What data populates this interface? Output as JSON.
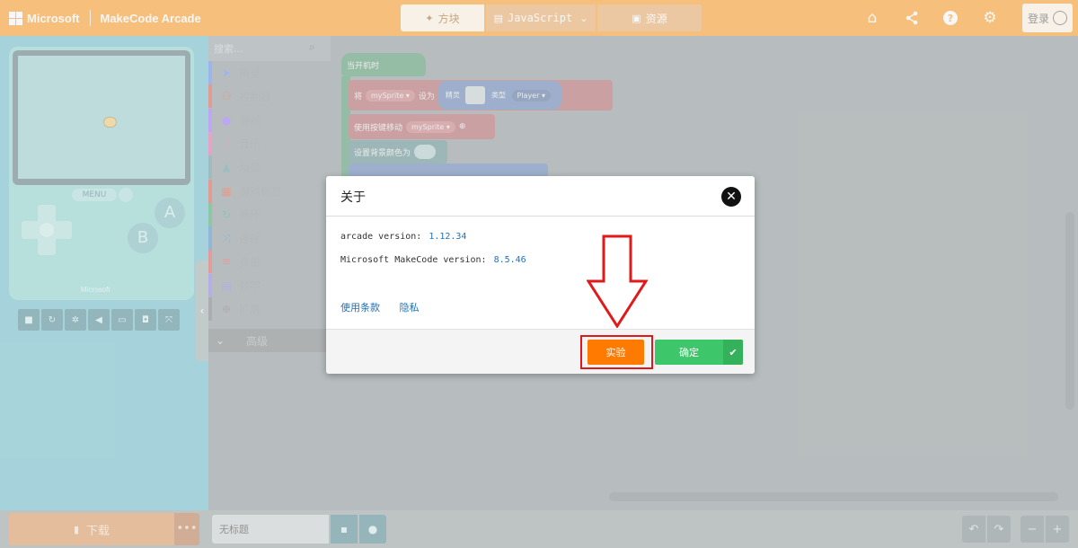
{
  "header": {
    "brand_ms": "Microsoft",
    "brand_app": "MakeCode Arcade",
    "tabs": [
      {
        "label": "方块",
        "icon": "puzzle-icon",
        "active": true
      },
      {
        "label": "JavaScript",
        "icon": "js-icon"
      },
      {
        "label": "资源",
        "icon": "image-icon"
      }
    ],
    "icons": [
      "home-icon",
      "share-icon",
      "help-icon",
      "settings-icon"
    ],
    "signin_label": "登录",
    "accent": "#ff8f08"
  },
  "simulator": {
    "menu_label": "MENU",
    "button_a": "A",
    "button_b": "B",
    "console_brand": "Microsoft",
    "toolbar_icons": [
      "stop-icon",
      "restart-icon",
      "debug-icon",
      "sound-icon",
      "keyboard-icon",
      "screenshot-icon",
      "fullscreen-icon"
    ]
  },
  "toolbox": {
    "search_placeholder": "搜索...",
    "categories": [
      {
        "label": "精灵",
        "color": "#4b7bec"
      },
      {
        "label": "控制器",
        "color": "#d6472f"
      },
      {
        "label": "游戏",
        "color": "#8b5cf6"
      },
      {
        "label": "音乐",
        "color": "#e0559c"
      },
      {
        "label": "场景",
        "color": "#4b8b8f"
      },
      {
        "label": "游戏信息",
        "color": "#d6472f"
      },
      {
        "label": "循环",
        "color": "#23a35a"
      },
      {
        "label": "逻辑",
        "color": "#2f7fc0"
      },
      {
        "label": "变量",
        "color": "#d64848"
      },
      {
        "label": "数学",
        "color": "#7b6ad8"
      },
      {
        "label": "扩展",
        "color": "#6a6a6a"
      }
    ],
    "advanced_label": "高级"
  },
  "workspace": {
    "on_start": "当开机时",
    "set_prefix": "将",
    "var_name": "mySprite",
    "set_to": "设为",
    "sprite_word": "精灵",
    "kind_word": "类型",
    "kind_value": "Player",
    "move_label": "使用按键移动",
    "bg_label": "设置背景颜色为"
  },
  "bottom": {
    "download_label": "下载",
    "more_label": "•••",
    "project_name": "无标题"
  },
  "modal": {
    "title": "关于",
    "close_icon": "close-icon",
    "arcade_version_label": "arcade version:",
    "arcade_version": "1.12.34",
    "makecode_version_label": "Microsoft MakeCode version:",
    "makecode_version": "8.5.46",
    "terms_link": "使用条款",
    "privacy_link": "隐私",
    "experiments_label": "实验",
    "ok_label": "确定",
    "highlight_color": "#e0191a"
  }
}
